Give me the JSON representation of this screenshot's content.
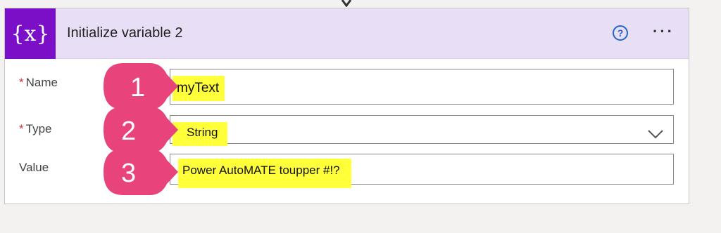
{
  "card": {
    "icon_text": "{x}",
    "title": "Initialize variable 2",
    "help_icon": "question-circle-icon",
    "more_icon": "more-ellipsis-icon",
    "more_text": "···"
  },
  "fields": {
    "name": {
      "label": "Name",
      "required_mark": "*",
      "value": "myText"
    },
    "type": {
      "label": "Type",
      "required_mark": "*",
      "value": "String",
      "dropdown_icon": "chevron-down-icon"
    },
    "value": {
      "label": "Value",
      "value": "Power AutoMATE toupper #!?"
    }
  },
  "badges": [
    "1",
    "2",
    "3"
  ],
  "colors": {
    "header_bg": "#e8dff6",
    "icon_bg": "#7b0fc7",
    "highlight": "#ffff3a",
    "badge_pink": "#e8437a",
    "required": "#d13438",
    "help": "#2266cc"
  }
}
